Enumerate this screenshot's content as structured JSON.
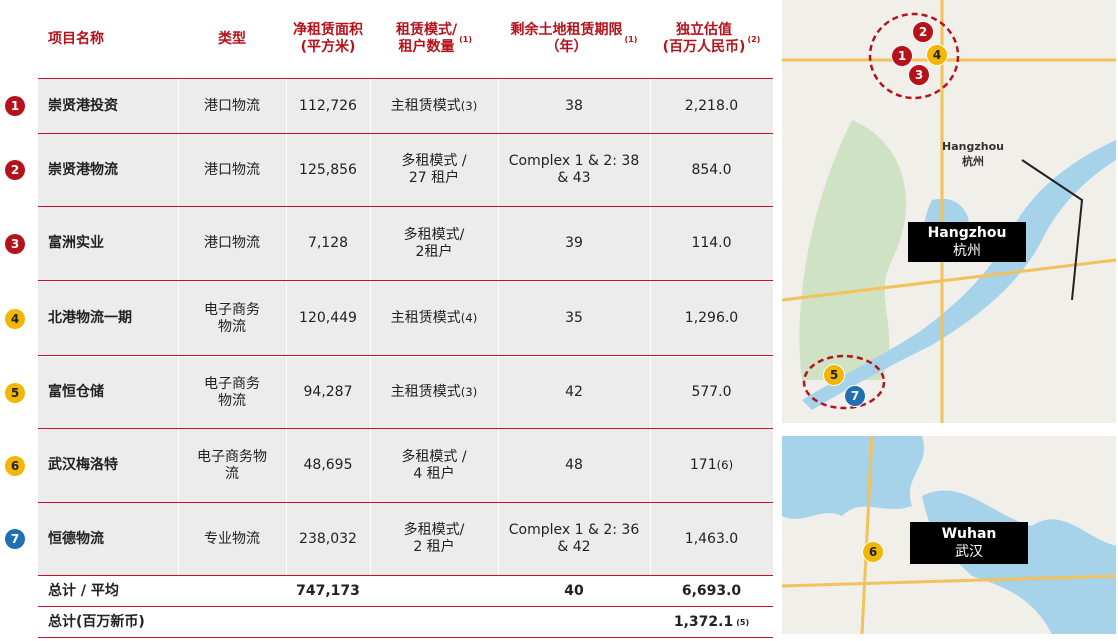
{
  "headers": {
    "name": "项目名称",
    "type": "类型",
    "area": "净租赁面积\n(平方米)",
    "mode": "租赁模式/\n租户数量",
    "mode_note": "(1)",
    "term": "剩余土地租赁期限\n（年）",
    "term_note": "(1)",
    "valuation": "独立估值\n(百万人民币)",
    "valuation_note": "(2)"
  },
  "rows": [
    {
      "num": "1",
      "name": "崇贤港投资",
      "type": "港口物流",
      "area": "112,726",
      "mode": "主租赁模式",
      "mode_note": "(3)",
      "term": "38",
      "value": "2,218.0",
      "value_note": ""
    },
    {
      "num": "2",
      "name": "崇贤港物流",
      "type": "港口物流",
      "area": "125,856",
      "mode": "多租模式 /\n27 租户",
      "mode_note": "",
      "term": "Complex 1 & 2: 38\n& 43",
      "value": "854.0",
      "value_note": ""
    },
    {
      "num": "3",
      "name": "富洲实业",
      "type": "港口物流",
      "area": "7,128",
      "mode": "多租模式/\n2租户",
      "mode_note": "",
      "term": "39",
      "value": "114.0",
      "value_note": ""
    },
    {
      "num": "4",
      "name": "北港物流一期",
      "type": "电子商务\n物流",
      "area": "120,449",
      "mode": "主租赁模式",
      "mode_note": "(4)",
      "term": "35",
      "value": "1,296.0",
      "value_note": ""
    },
    {
      "num": "5",
      "name": "富恒仓储",
      "type": "电子商务\n物流",
      "area": "94,287",
      "mode": "主租赁模式",
      "mode_note": "(3)",
      "term": "42",
      "value": "577.0",
      "value_note": ""
    },
    {
      "num": "6",
      "name": "武汉梅洛特",
      "type": "电子商务物\n流",
      "area": "48,695",
      "mode": "多租模式 /\n4 租户",
      "mode_note": "",
      "term": "48",
      "value": "171",
      "value_note": "(6)"
    },
    {
      "num": "7",
      "name": "恒德物流",
      "type": "专业物流",
      "area": "238,032",
      "mode": "多租模式/\n2 租户",
      "mode_note": "",
      "term": "Complex 1 & 2: 36\n& 42",
      "value": "1,463.0",
      "value_note": ""
    }
  ],
  "total": {
    "label": "总计 / 平均",
    "area": "747,173",
    "term": "40",
    "value": "6,693.0"
  },
  "total_sgd": {
    "label": "总计(百万新币)",
    "value": "1,372.1",
    "note": "(5)"
  },
  "maps": {
    "hangzhou": {
      "label_en": "Hangzhou",
      "label_cn": "杭州",
      "city_en": "Hangzhou",
      "city_cn": "杭州",
      "pins": [
        "1",
        "2",
        "3",
        "4",
        "5",
        "7"
      ]
    },
    "wuhan": {
      "label_en": "Wuhan",
      "label_cn": "武汉",
      "pins": [
        "6"
      ]
    }
  },
  "colors": {
    "red": "#b5121b",
    "yellow": "#f2b705",
    "blue": "#1f6fb2",
    "rule": "#c8102e",
    "shade": "#ececec"
  }
}
